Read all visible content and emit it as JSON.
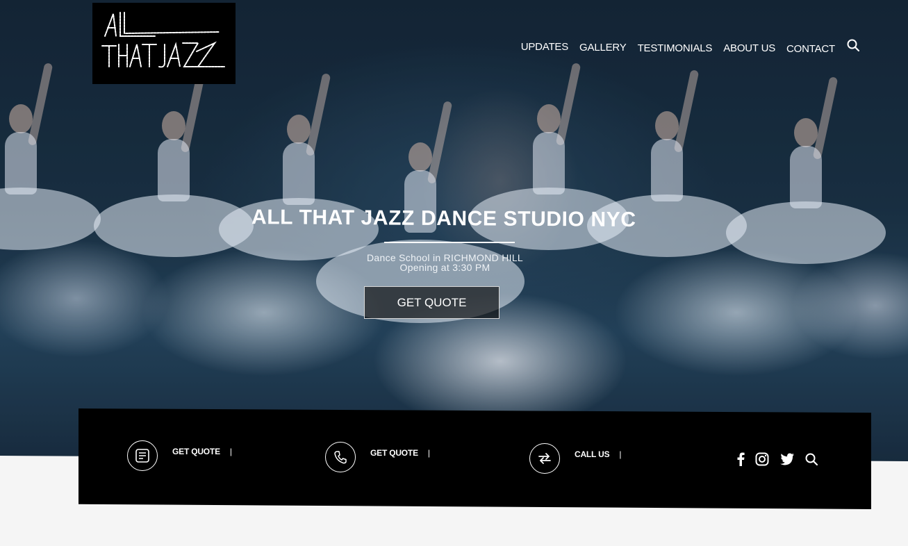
{
  "brand": {
    "logo_line1": "ALL",
    "logo_line2": "THAT JAZZ"
  },
  "nav": {
    "items": [
      "UPDATES",
      "GALLERY",
      "TESTIMONIALS",
      "ABOUT US",
      "CONTACT"
    ],
    "search_icon": "search-icon"
  },
  "hero": {
    "title": "ALL THAT JAZZ DANCE STUDIO NYC",
    "subtitle_line1": "Dance School in RICHMOND HILL",
    "subtitle_line2": "Opening at 3:30 PM",
    "cta_label": "GET QUOTE"
  },
  "infobar": {
    "items": [
      {
        "icon": "form-icon",
        "label": "GET QUOTE",
        "separator": "|"
      },
      {
        "icon": "phone-icon",
        "label": "GET QUOTE",
        "separator": "|"
      },
      {
        "icon": "swap-arrows-icon",
        "label": "CALL US",
        "separator": "|"
      }
    ],
    "social": [
      "facebook-icon",
      "instagram-icon",
      "twitter-icon",
      "search-icon"
    ]
  },
  "colors": {
    "bar": "#000000",
    "text": "#ffffff",
    "page_bg": "#f5f5f5"
  }
}
